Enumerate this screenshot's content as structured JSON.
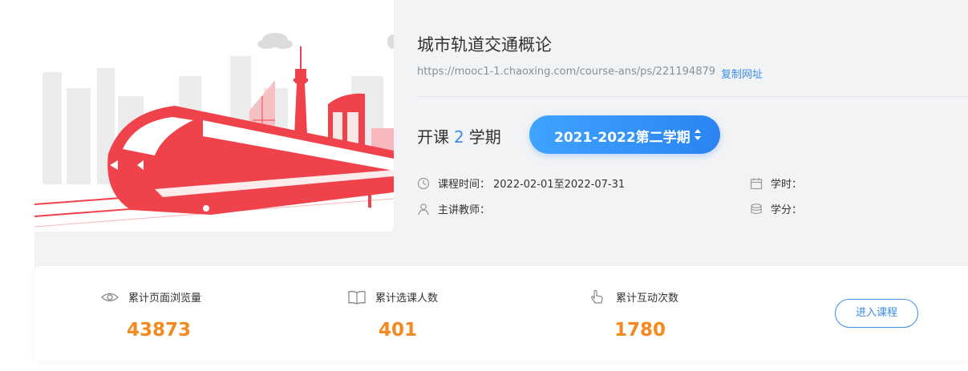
{
  "course": {
    "title": "城市轨道交通概论",
    "url": "https://mooc1-1.chaoxing.com/course-ans/ps/221194879",
    "copy_label": "复制网址"
  },
  "terms": {
    "prefix": "开课",
    "count": "2",
    "suffix": "学期",
    "selected": "2021-2022第二学期"
  },
  "info": {
    "time_label": "课程时间：",
    "time_value": "2022-02-01至2022-07-31",
    "teacher_label": "主讲教师：",
    "hours_label": "学时：",
    "credits_label": "学分："
  },
  "stats": {
    "views_label": "累计页面浏览量",
    "views_value": "43873",
    "enrolled_label": "累计选课人数",
    "enrolled_value": "401",
    "interactions_label": "累计互动次数",
    "interactions_value": "1780",
    "enter_button": "进入课程"
  },
  "colors": {
    "accent_blue": "#3a8ee6",
    "number_orange": "#f5891f",
    "train_red": "#f0424b"
  },
  "icons": [
    "clock-icon",
    "teacher-icon",
    "calendar-icon",
    "coins-icon",
    "eye-icon",
    "book-icon",
    "hand-pointer-icon",
    "sort-arrows-icon"
  ]
}
